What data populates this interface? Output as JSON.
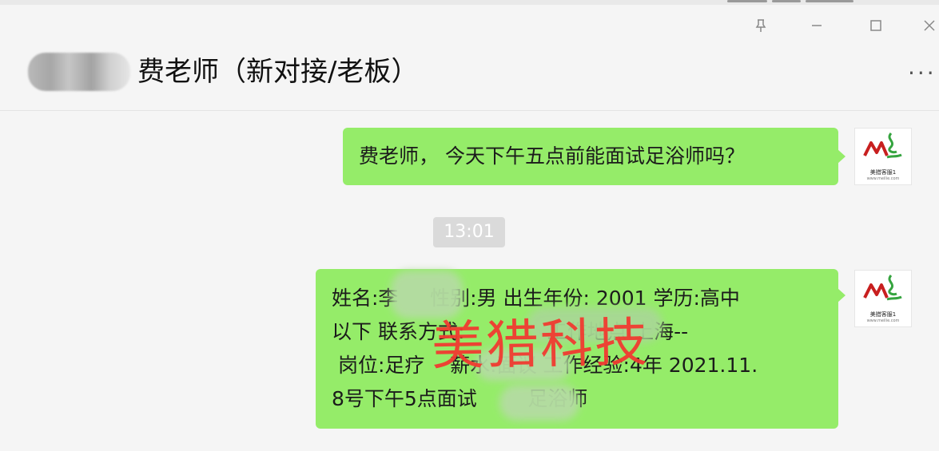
{
  "window": {
    "controls": {
      "pin": "pin-icon",
      "minimize": "minimize-icon",
      "maximize": "maximize-icon",
      "close": "close-icon"
    }
  },
  "chat": {
    "title": "费老师（新对接/老板）",
    "more": "···",
    "avatar": "blurred-avatar"
  },
  "messages": [
    {
      "text": "费老师， 今天下午五点前能面试足浴师吗？",
      "sender_logo": "美猎客服1"
    },
    {
      "timestamp": "13:01"
    },
    {
      "text": "姓名:李     性别:男 出生年份: 2001 学历:高中\n以下 联系方式:             工作地点:上海--\n 岗位:足疗    薪水:面议 工作经验:4年 2021.11.\n8号下午5点面试        足浴师",
      "sender_logo": "美猎客服1"
    }
  ],
  "watermark": "美猎科技",
  "colors": {
    "bubble_green": "#95ec69",
    "watermark_red": "#f13b31",
    "logo_red": "#c81f1f",
    "logo_green": "#35a43f"
  }
}
